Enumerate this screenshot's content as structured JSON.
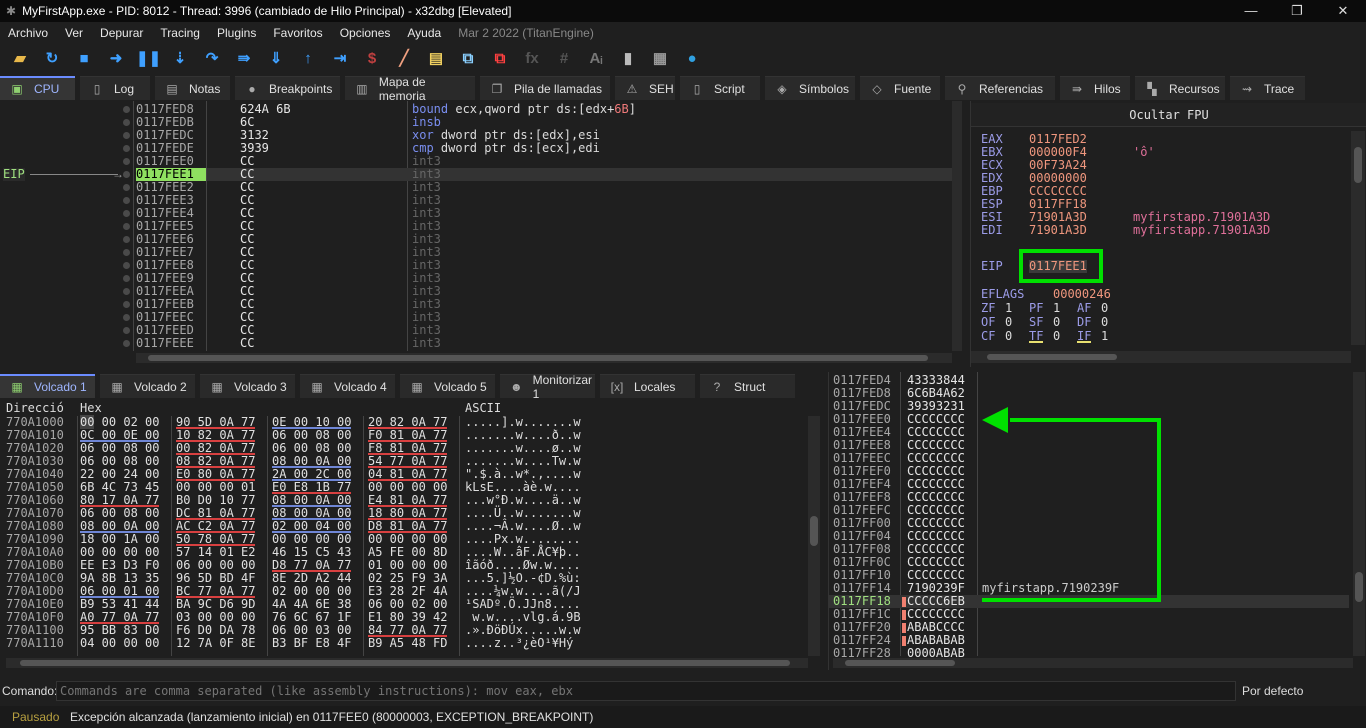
{
  "window": {
    "title": "MyFirstApp.exe - PID: 8012 - Thread: 3996 (cambiado de Hilo Principal) - x32dbg [Elevated]",
    "controls": [
      "—",
      "❐",
      "✕"
    ]
  },
  "menu": {
    "items": [
      "Archivo",
      "Ver",
      "Depurar",
      "Tracing",
      "Plugins",
      "Favoritos",
      "Opciones",
      "Ayuda"
    ],
    "version": "Mar 2 2022 (TitanEngine)"
  },
  "toolbar": [
    {
      "icon": "open-folder-icon",
      "glyph": "▰",
      "color": "#e8b84a"
    },
    {
      "icon": "restart-icon",
      "glyph": "↻",
      "color": "#3fa0ff"
    },
    {
      "icon": "stop-icon",
      "glyph": "■",
      "color": "#3fa0ff"
    },
    {
      "icon": "run-icon",
      "glyph": "➜",
      "color": "#3fa0ff"
    },
    {
      "icon": "pause-icon",
      "glyph": "❚❚",
      "color": "#3fa0ff"
    },
    {
      "icon": "step-into-icon",
      "glyph": "⇣",
      "color": "#3fa0ff"
    },
    {
      "icon": "step-over-icon",
      "glyph": "↷",
      "color": "#3fa0ff"
    },
    {
      "icon": "trace-into-icon",
      "glyph": "⇛",
      "color": "#3fa0ff"
    },
    {
      "icon": "trace-over-icon",
      "glyph": "⇓",
      "color": "#3fa0ff"
    },
    {
      "icon": "execute-till-return-icon",
      "glyph": "↑",
      "color": "#3fa0ff"
    },
    {
      "icon": "run-to-user-code-icon",
      "glyph": "⇥",
      "color": "#3fa0ff"
    },
    {
      "icon": "scylla-icon",
      "glyph": "$",
      "color": "#c04040"
    },
    {
      "icon": "patch-icon",
      "glyph": "╱",
      "color": "#f0a080"
    },
    {
      "icon": "comments-icon",
      "glyph": "▤",
      "color": "#f0d060"
    },
    {
      "icon": "labels-icon",
      "glyph": "⧉",
      "color": "#8ad0ff"
    },
    {
      "icon": "bookmarks-icon",
      "glyph": "⧉",
      "color": "#ff4040"
    },
    {
      "icon": "function-icon",
      "glyph": "fx",
      "color": "#555"
    },
    {
      "icon": "hash-icon",
      "glyph": "#",
      "color": "#555"
    },
    {
      "icon": "font-icon",
      "glyph": "Aᵢ",
      "color": "#777"
    },
    {
      "icon": "device-icon",
      "glyph": "▮",
      "color": "#bbb"
    },
    {
      "icon": "calculator-icon",
      "glyph": "▦",
      "color": "#999"
    },
    {
      "icon": "globe-icon",
      "glyph": "●",
      "color": "#30a0e0"
    }
  ],
  "top_tabs": [
    {
      "label": "CPU",
      "icon": "cpu-icon",
      "glyph": "▣",
      "w": 75,
      "active": true
    },
    {
      "label": "Log",
      "icon": "log-icon",
      "glyph": "▯",
      "w": 70
    },
    {
      "label": "Notas",
      "icon": "notes-icon",
      "glyph": "▤",
      "w": 75
    },
    {
      "label": "Breakpoints",
      "icon": "breakpoint-icon",
      "glyph": "●",
      "w": 105
    },
    {
      "label": "Mapa de memoria",
      "icon": "memory-map-icon",
      "glyph": "▥",
      "w": 130
    },
    {
      "label": "Pila de llamadas",
      "icon": "call-stack-icon",
      "glyph": "❐",
      "w": 130
    },
    {
      "label": "SEH",
      "icon": "seh-icon",
      "glyph": "⚠",
      "w": 60
    },
    {
      "label": "Script",
      "icon": "script-icon",
      "glyph": "▯",
      "w": 80
    },
    {
      "label": "Símbolos",
      "icon": "symbols-icon",
      "glyph": "◈",
      "w": 90
    },
    {
      "label": "Fuente",
      "icon": "source-icon",
      "glyph": "◇",
      "w": 80
    },
    {
      "label": "Referencias",
      "icon": "references-icon",
      "glyph": "⚲",
      "w": 110
    },
    {
      "label": "Hilos",
      "icon": "threads-icon",
      "glyph": "⇛",
      "w": 70
    },
    {
      "label": "Recursos",
      "icon": "handles-icon",
      "glyph": "▚",
      "w": 90
    },
    {
      "label": "Trace",
      "icon": "trace-icon",
      "glyph": "⇝",
      "w": 75
    }
  ],
  "disasm": {
    "eip_label": "EIP",
    "rows": [
      {
        "addr": "0117FED8",
        "bytes": "624A 6B",
        "mn": "bound",
        "ops": [
          [
            "op",
            " ecx,qword ptr ds:[edx+"
          ],
          [
            "num",
            "6B"
          ],
          [
            "op",
            "]"
          ]
        ]
      },
      {
        "addr": "0117FEDB",
        "bytes": "6C",
        "mn": "insb",
        "ops": []
      },
      {
        "addr": "0117FEDC",
        "bytes": "3132",
        "mn": "xor",
        "ops": [
          [
            "op",
            " dword ptr ds:[edx],esi"
          ]
        ]
      },
      {
        "addr": "0117FEDE",
        "bytes": "3939",
        "mn": "cmp",
        "ops": [
          [
            "op",
            " dword ptr ds:[ecx],edi"
          ]
        ]
      },
      {
        "addr": "0117FEE0",
        "bytes": "CC",
        "mn": "int3",
        "ops": []
      },
      {
        "addr": "0117FEE1",
        "bytes": "CC",
        "mn": "int3",
        "ops": [],
        "eip": true
      },
      {
        "addr": "0117FEE2",
        "bytes": "CC",
        "mn": "int3",
        "ops": []
      },
      {
        "addr": "0117FEE3",
        "bytes": "CC",
        "mn": "int3",
        "ops": []
      },
      {
        "addr": "0117FEE4",
        "bytes": "CC",
        "mn": "int3",
        "ops": []
      },
      {
        "addr": "0117FEE5",
        "bytes": "CC",
        "mn": "int3",
        "ops": []
      },
      {
        "addr": "0117FEE6",
        "bytes": "CC",
        "mn": "int3",
        "ops": []
      },
      {
        "addr": "0117FEE7",
        "bytes": "CC",
        "mn": "int3",
        "ops": []
      },
      {
        "addr": "0117FEE8",
        "bytes": "CC",
        "mn": "int3",
        "ops": []
      },
      {
        "addr": "0117FEE9",
        "bytes": "CC",
        "mn": "int3",
        "ops": []
      },
      {
        "addr": "0117FEEA",
        "bytes": "CC",
        "mn": "int3",
        "ops": []
      },
      {
        "addr": "0117FEEB",
        "bytes": "CC",
        "mn": "int3",
        "ops": []
      },
      {
        "addr": "0117FEEC",
        "bytes": "CC",
        "mn": "int3",
        "ops": []
      },
      {
        "addr": "0117FEED",
        "bytes": "CC",
        "mn": "int3",
        "ops": []
      },
      {
        "addr": "0117FEEE",
        "bytes": "CC",
        "mn": "int3",
        "ops": []
      }
    ]
  },
  "registers": {
    "header": "Ocultar FPU",
    "gp": [
      {
        "name": "EAX",
        "value": "0117FED2",
        "comment": ""
      },
      {
        "name": "EBX",
        "value": "000000F4",
        "comment": "'ô'"
      },
      {
        "name": "ECX",
        "value": "00F73A24",
        "comment": ""
      },
      {
        "name": "EDX",
        "value": "00000000",
        "comment": ""
      },
      {
        "name": "EBP",
        "value": "CCCCCCCC",
        "comment": ""
      },
      {
        "name": "ESP",
        "value": "0117FF18",
        "comment": ""
      },
      {
        "name": "ESI",
        "value": "71901A3D",
        "comment": "myfirstapp.71901A3D"
      },
      {
        "name": "EDI",
        "value": "71901A3D",
        "comment": "myfirstapp.71901A3D"
      }
    ],
    "eip": {
      "name": "EIP",
      "value": "0117FEE1"
    },
    "eflags": {
      "name": "EFLAGS",
      "value": "00000246"
    },
    "flags": [
      [
        [
          "ZF",
          "1"
        ],
        [
          "PF",
          "1"
        ],
        [
          "AF",
          "0"
        ]
      ],
      [
        [
          "OF",
          "0"
        ],
        [
          "SF",
          "0"
        ],
        [
          "DF",
          "0"
        ]
      ],
      [
        [
          "CF",
          "0"
        ],
        [
          "TF",
          "0"
        ],
        [
          "IF",
          "1"
        ]
      ]
    ],
    "highlight_color": "#00e000"
  },
  "bottom_tabs": [
    {
      "label": "Volcado 1",
      "icon": "dump-icon",
      "glyph": "▦",
      "active": true
    },
    {
      "label": "Volcado 2",
      "icon": "dump-icon",
      "glyph": "▦"
    },
    {
      "label": "Volcado 3",
      "icon": "dump-icon",
      "glyph": "▦"
    },
    {
      "label": "Volcado 4",
      "icon": "dump-icon",
      "glyph": "▦"
    },
    {
      "label": "Volcado 5",
      "icon": "dump-icon",
      "glyph": "▦"
    },
    {
      "label": "Monitorizar 1",
      "icon": "watch-icon",
      "glyph": "☻"
    },
    {
      "label": "Locales",
      "icon": "locals-icon",
      "glyph": "[x]"
    },
    {
      "label": "Struct",
      "icon": "struct-icon",
      "glyph": "?"
    }
  ],
  "dump": {
    "headers": {
      "addr": "Direcció",
      "hex": "Hex",
      "ascii": "ASCII"
    },
    "rows": [
      {
        "addr": "770A1000",
        "g": [
          "00 00 02 00",
          "90 5D 0A 77",
          "0E 00 10 00",
          "20 82 0A 77"
        ],
        "u": [
          "",
          "r",
          "b",
          "r"
        ],
        "ascii": ".....].w.......w"
      },
      {
        "addr": "770A1010",
        "g": [
          "0C 00 0E 00",
          "10 82 0A 77",
          "06 00 08 00",
          "F0 81 0A 77"
        ],
        "u": [
          "b",
          "r",
          "",
          "r"
        ],
        "ascii": ".......w....ð..w"
      },
      {
        "addr": "770A1020",
        "g": [
          "06 00 08 00",
          "00 82 0A 77",
          "06 00 08 00",
          "F8 81 0A 77"
        ],
        "u": [
          "",
          "r",
          "",
          "r"
        ],
        "ascii": ".......w....ø..w"
      },
      {
        "addr": "770A1030",
        "g": [
          "06 00 08 00",
          "08 82 0A 77",
          "08 00 0A 00",
          "54 77 0A 77"
        ],
        "u": [
          "",
          "r",
          "b",
          "r"
        ],
        "ascii": ".......w....Tw.w"
      },
      {
        "addr": "770A1040",
        "g": [
          "22 00 24 00",
          "E0 80 0A 77",
          "2A 00 2C 00",
          "04 81 0A 77"
        ],
        "u": [
          "",
          "r",
          "b",
          "r"
        ],
        "ascii": "\".$.à..w*.,....w"
      },
      {
        "addr": "770A1050",
        "g": [
          "6B 4C 73 45",
          "00 00 00 01",
          "E0 E8 1B 77",
          "00 00 00 00"
        ],
        "u": [
          "",
          "",
          "r",
          ""
        ],
        "ascii": "kLsE....àè.w...."
      },
      {
        "addr": "770A1060",
        "g": [
          "80 17 0A 77",
          "B0 D0 10 77",
          "08 00 0A 00",
          "E4 81 0A 77"
        ],
        "u": [
          "r",
          "",
          "b",
          "r"
        ],
        "ascii": "...w°Ð.w....ä..w"
      },
      {
        "addr": "770A1070",
        "g": [
          "06 00 08 00",
          "DC 81 0A 77",
          "08 00 0A 00",
          "18 80 0A 77"
        ],
        "u": [
          "",
          "r",
          "b",
          "r"
        ],
        "ascii": "....Ü..w.......w"
      },
      {
        "addr": "770A1080",
        "g": [
          "08 00 0A 00",
          "AC C2 0A 77",
          "02 00 04 00",
          "D8 81 0A 77"
        ],
        "u": [
          "b",
          "r",
          "b",
          "r"
        ],
        "ascii": "....¬Â.w....Ø..w"
      },
      {
        "addr": "770A1090",
        "g": [
          "18 00 1A 00",
          "50 78 0A 77",
          "00 00 00 00",
          "00 00 00 00"
        ],
        "u": [
          "",
          "r",
          "",
          ""
        ],
        "ascii": "....Px.w........"
      },
      {
        "addr": "770A10A0",
        "g": [
          "00 00 00 00",
          "57 14 01 E2",
          "46 15 C5 43",
          "A5 FE 00 8D"
        ],
        "u": [
          "",
          "",
          "",
          ""
        ],
        "ascii": "....W..âF.ÅC¥þ.."
      },
      {
        "addr": "770A10B0",
        "g": [
          "EE E3 D3 F0",
          "06 00 00 00",
          "D8 77 0A 77",
          "01 00 00 00"
        ],
        "u": [
          "",
          "",
          "r",
          ""
        ],
        "ascii": "îãóð....Øw.w...."
      },
      {
        "addr": "770A10C0",
        "g": [
          "9A 8B 13 35",
          "96 5D BD 4F",
          "8E 2D A2 44",
          "02 25 F9 3A"
        ],
        "u": [
          "",
          "",
          "",
          ""
        ],
        "ascii": "...5.]½O.-¢D.%ù:"
      },
      {
        "addr": "770A10D0",
        "g": [
          "06 00 01 00",
          "BC 77 0A 77",
          "02 00 00 00",
          "E3 28 2F 4A"
        ],
        "u": [
          "b",
          "r",
          "",
          ""
        ],
        "ascii": "....¼w.w....ã(/J"
      },
      {
        "addr": "770A10E0",
        "g": [
          "B9 53 41 44",
          "BA 9C D6 9D",
          "4A 4A 6E 38",
          "06 00 02 00"
        ],
        "u": [
          "",
          "",
          "",
          ""
        ],
        "ascii": "¹SADº.Ö.JJn8...."
      },
      {
        "addr": "770A10F0",
        "g": [
          "A0 77 0A 77",
          "03 00 00 00",
          "76 6C 67 1F",
          "E1 80 39 42"
        ],
        "u": [
          "r",
          "",
          "",
          ""
        ],
        "ascii": " w.w....vlg.á.9B"
      },
      {
        "addr": "770A1100",
        "g": [
          "95 BB 83 D0",
          "F6 D0 DA 78",
          "06 00 03 00",
          "84 77 0A 77"
        ],
        "u": [
          "",
          "",
          "",
          "r"
        ],
        "ascii": ".».ÐöÐÚx.....w.w"
      },
      {
        "addr": "770A1110",
        "g": [
          "04 00 00 00",
          "12 7A 0F 8E",
          "B3 BF E8 4F",
          "B9 A5 48 FD"
        ],
        "u": [
          "",
          "",
          "",
          ""
        ],
        "ascii": "....z..³¿èO¹¥Hý"
      }
    ]
  },
  "stack": {
    "rows": [
      {
        "addr": "0117FED4",
        "value": "43333844",
        "comment": ""
      },
      {
        "addr": "0117FED8",
        "value": "6C6B4A62",
        "comment": ""
      },
      {
        "addr": "0117FEDC",
        "value": "39393231",
        "comment": ""
      },
      {
        "addr": "0117FEE0",
        "value": "CCCCCCCC",
        "comment": ""
      },
      {
        "addr": "0117FEE4",
        "value": "CCCCCCCC",
        "comment": ""
      },
      {
        "addr": "0117FEE8",
        "value": "CCCCCCCC",
        "comment": ""
      },
      {
        "addr": "0117FEEC",
        "value": "CCCCCCCC",
        "comment": ""
      },
      {
        "addr": "0117FEF0",
        "value": "CCCCCCCC",
        "comment": ""
      },
      {
        "addr": "0117FEF4",
        "value": "CCCCCCCC",
        "comment": ""
      },
      {
        "addr": "0117FEF8",
        "value": "CCCCCCCC",
        "comment": ""
      },
      {
        "addr": "0117FEFC",
        "value": "CCCCCCCC",
        "comment": ""
      },
      {
        "addr": "0117FF00",
        "value": "CCCCCCCC",
        "comment": ""
      },
      {
        "addr": "0117FF04",
        "value": "CCCCCCCC",
        "comment": ""
      },
      {
        "addr": "0117FF08",
        "value": "CCCCCCCC",
        "comment": ""
      },
      {
        "addr": "0117FF0C",
        "value": "CCCCCCCC",
        "comment": ""
      },
      {
        "addr": "0117FF10",
        "value": "CCCCCCCC",
        "comment": ""
      },
      {
        "addr": "0117FF14",
        "value": "7190239F",
        "comment": "myfirstapp.7190239F"
      },
      {
        "addr": "0117FF18",
        "value": "CCCCC6EB",
        "comment": "",
        "esp": true,
        "mark": true
      },
      {
        "addr": "0117FF1C",
        "value": "CCCCCCCC",
        "comment": "",
        "mark": true
      },
      {
        "addr": "0117FF20",
        "value": "ABABCCCC",
        "comment": "",
        "mark": true
      },
      {
        "addr": "0117FF24",
        "value": "ABABABAB",
        "comment": "",
        "mark": true
      },
      {
        "addr": "0117FF28",
        "value": "0000ABAB",
        "comment": ""
      }
    ],
    "annotation_color": "#00e000"
  },
  "command": {
    "label": "Comando:",
    "placeholder": "Commands are comma separated (like assembly instructions): mov eax, ebx",
    "mode": "Por defecto"
  },
  "status": {
    "state": "Pausado",
    "message": "Excepción alcanzada (lanzamiento inicial) en 0117FEE0 (80000003, EXCEPTION_BREAKPOINT)"
  }
}
